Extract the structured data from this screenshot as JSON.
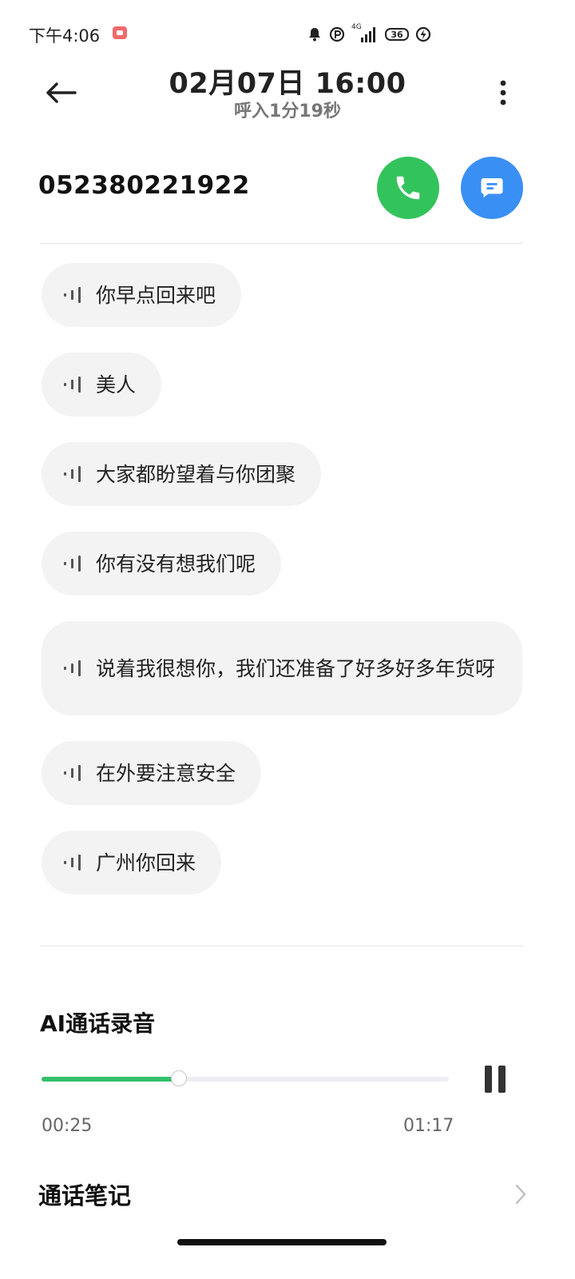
{
  "status_bar": {
    "time": "下午4:06",
    "network": "4G",
    "battery": "36",
    "icons": [
      "recording-icon",
      "notification-bell-icon",
      "data-saver-icon",
      "signal-icon",
      "battery-icon",
      "charging-icon"
    ]
  },
  "header": {
    "datetime": "02月07日 16:00",
    "subtitle": "呼入1分19秒"
  },
  "contact": {
    "number": "052380221922"
  },
  "transcript": [
    {
      "text": "你早点回来吧"
    },
    {
      "text": "美人"
    },
    {
      "text": "大家都盼望着与你团聚"
    },
    {
      "text": "你有没有想我们呢"
    },
    {
      "text": "说着我很想你，我们还准备了好多好多年货呀"
    },
    {
      "text": "在外要注意安全"
    },
    {
      "text": "广州你回来"
    }
  ],
  "ai_recording": {
    "title": "AI通话录音",
    "current_time": "00:25",
    "total_time": "01:17",
    "progress_fraction": 0.3376
  },
  "notes": {
    "label": "通话笔记"
  },
  "colors": {
    "call_green": "#33c35c",
    "message_blue": "#3a8ff5",
    "progress_green": "#33c06a",
    "bubble_bg": "#f3f3f3"
  }
}
